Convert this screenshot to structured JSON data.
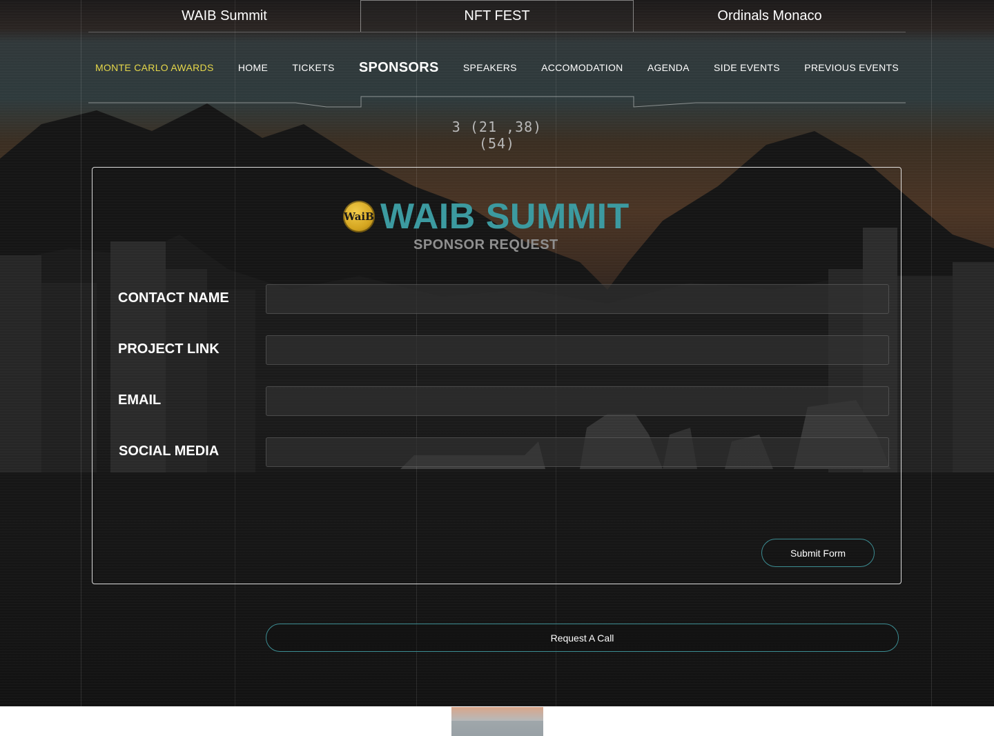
{
  "site_tabs": [
    {
      "label": "WAIB Summit"
    },
    {
      "label": "NFT FEST"
    },
    {
      "label": "Ordinals Monaco"
    }
  ],
  "nav": {
    "items": [
      {
        "label": "MONTE  CARLO AWARDS"
      },
      {
        "label": "HOME"
      },
      {
        "label": "TICKETS"
      },
      {
        "label": "SPONSORS"
      },
      {
        "label": "SPEAKERS"
      },
      {
        "label": "ACCOMODATION"
      },
      {
        "label": "AGENDA"
      },
      {
        "label": "SIDE EVENTS"
      },
      {
        "label": "PREVIOUS EVENTS"
      }
    ],
    "active": "SPONSORS"
  },
  "countdown": "3 (21 ,38)(54)",
  "form": {
    "brand_logo_text": "WaiB",
    "brand_title": "WAIB SUMMIT",
    "subtitle": "SPONSOR REQUEST",
    "fields": [
      {
        "label": "CONTACT NAME",
        "value": ""
      },
      {
        "label": "PROJECT LINK",
        "value": ""
      },
      {
        "label": "EMAIL",
        "value": ""
      },
      {
        "label": "SOCIAL MEDIA",
        "value": ""
      }
    ],
    "submit_label": "Submit Form"
  },
  "request_call_label": "Request A Call",
  "colors": {
    "accent_teal": "#3c9aa0",
    "awards_yellow": "#e6d84a",
    "subtitle_gray": "#8f8f8f"
  }
}
